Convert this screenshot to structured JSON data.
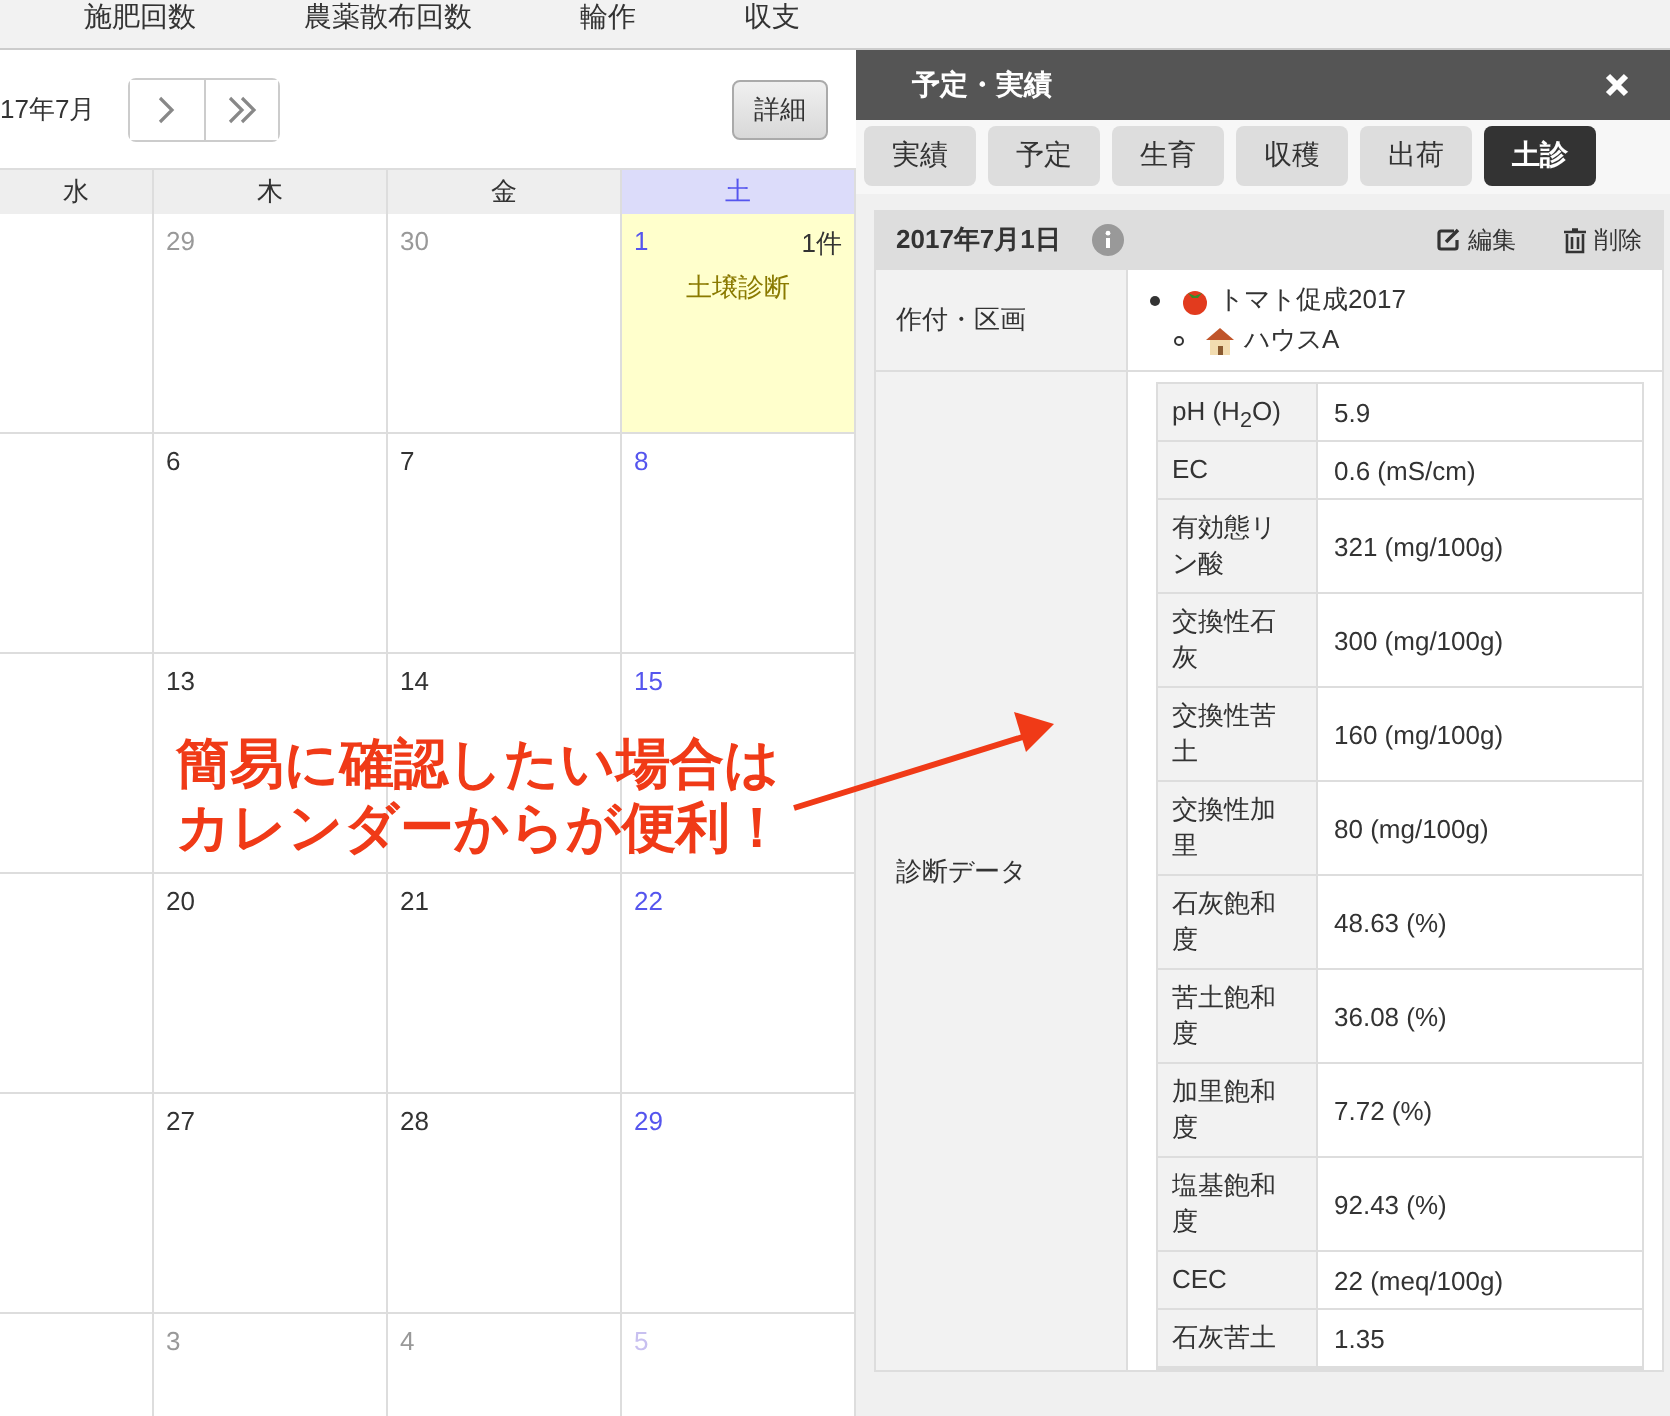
{
  "nav": [
    "施肥回数",
    "農薬散布回数",
    "輪作",
    "収支"
  ],
  "calendar": {
    "month": "17年7月",
    "detail_button": "詳細",
    "weekdays": [
      {
        "label": "水",
        "kind": "weekday"
      },
      {
        "label": "木",
        "kind": "weekday"
      },
      {
        "label": "金",
        "kind": "weekday"
      },
      {
        "label": "土",
        "kind": "saturday"
      }
    ],
    "weeks": [
      [
        {
          "day": "29",
          "other_month": true,
          "highlighted": false
        },
        {
          "day": "30",
          "other_month": true,
          "highlighted": false
        },
        {
          "day": "1",
          "other_month": false,
          "highlighted": true,
          "count": "1件",
          "event": "土壌診断"
        }
      ],
      [
        {
          "day": "6",
          "other_month": false,
          "highlighted": false
        },
        {
          "day": "7",
          "other_month": false,
          "highlighted": false
        },
        {
          "day": "8",
          "other_month": false,
          "highlighted": false
        }
      ],
      [
        {
          "day": "13",
          "other_month": false,
          "highlighted": false
        },
        {
          "day": "14",
          "other_month": false,
          "highlighted": false
        },
        {
          "day": "15",
          "other_month": false,
          "highlighted": false
        }
      ],
      [
        {
          "day": "20",
          "other_month": false,
          "highlighted": false
        },
        {
          "day": "21",
          "other_month": false,
          "highlighted": false
        },
        {
          "day": "22",
          "other_month": false,
          "highlighted": false
        }
      ],
      [
        {
          "day": "27",
          "other_month": false,
          "highlighted": false
        },
        {
          "day": "28",
          "other_month": false,
          "highlighted": false
        },
        {
          "day": "29",
          "other_month": false,
          "highlighted": false
        }
      ],
      [
        {
          "day": "3",
          "other_month": true,
          "highlighted": false
        },
        {
          "day": "4",
          "other_month": true,
          "highlighted": false
        },
        {
          "day": "5",
          "other_month": true,
          "highlighted": false
        }
      ]
    ]
  },
  "panel": {
    "title": "予定・実績",
    "tabs": [
      {
        "label": "実績",
        "selected": false
      },
      {
        "label": "予定",
        "selected": false
      },
      {
        "label": "生育",
        "selected": false
      },
      {
        "label": "収穫",
        "selected": false
      },
      {
        "label": "出荷",
        "selected": false
      },
      {
        "label": "土診",
        "selected": true
      }
    ],
    "record": {
      "date": "2017年7月1日",
      "actions": [
        {
          "kind": "edit",
          "label": "編集"
        },
        {
          "kind": "delete",
          "label": "削除"
        }
      ],
      "crop_label": "作付・区画",
      "crop": "トマト促成2017",
      "area": "ハウスA",
      "data_label": "診断データ",
      "measurements": [
        {
          "label": "pH (H$_{2}$O)",
          "value": "5.9"
        },
        {
          "label": "EC",
          "value": "0.6 (mS/cm)"
        },
        {
          "label": "有効態リン酸",
          "value": "321 (mg/100g)"
        },
        {
          "label": "交換性石灰",
          "value": "300 (mg/100g)"
        },
        {
          "label": "交換性苦土",
          "value": "160 (mg/100g)"
        },
        {
          "label": "交換性加里",
          "value": "80 (mg/100g)"
        },
        {
          "label": "石灰飽和度",
          "value": "48.63 (%)"
        },
        {
          "label": "苦土飽和度",
          "value": "36.08 (%)"
        },
        {
          "label": "加里飽和度",
          "value": "7.72 (%)"
        },
        {
          "label": "塩基飽和度",
          "value": "92.43 (%)"
        },
        {
          "label": "CEC",
          "value": "22 (meq/100g)"
        },
        {
          "label": "石灰苦土",
          "value": "1.35"
        }
      ]
    }
  },
  "annotation": {
    "lines": [
      "簡易に確認したい場合は",
      "カレンダーからが便利！"
    ]
  }
}
